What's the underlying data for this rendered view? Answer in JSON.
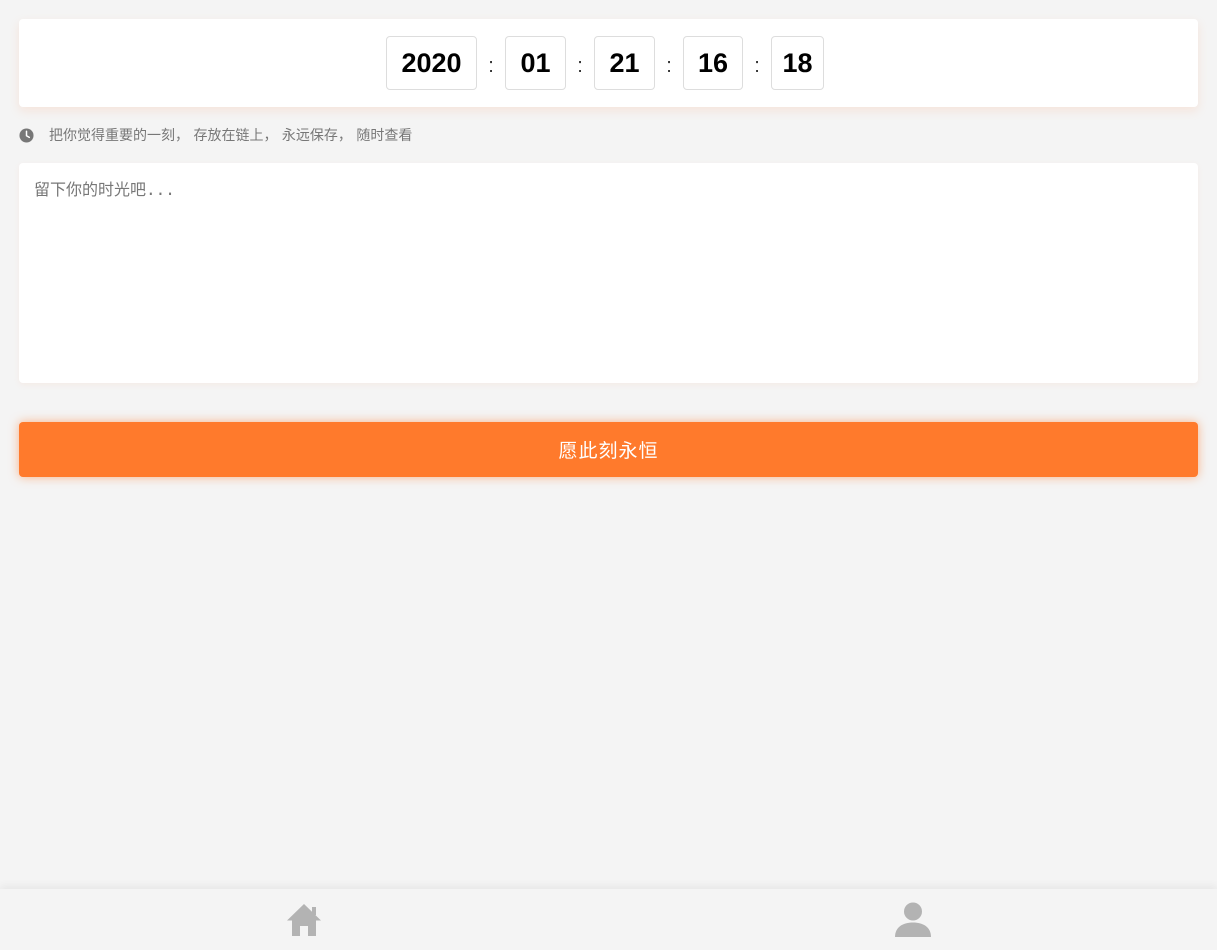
{
  "datetime": {
    "year": "2020",
    "month": "01",
    "day": "21",
    "hour": "16",
    "minute": "18",
    "separator": ":"
  },
  "hint": {
    "icon": "clock-icon",
    "text": "把你觉得重要的一刻， 存放在链上， 永远保存， 随时查看"
  },
  "memo": {
    "placeholder": "留下你的时光吧...",
    "value": ""
  },
  "submit": {
    "label": "愿此刻永恒"
  },
  "tabbar": {
    "items": [
      {
        "name": "home",
        "icon": "home-icon"
      },
      {
        "name": "profile",
        "icon": "user-icon"
      }
    ]
  },
  "colors": {
    "accent": "#ff7a2c",
    "background": "#f4f4f4",
    "card": "#ffffff",
    "tab_icon": "#b3b3b3",
    "hint_text": "#777777"
  }
}
